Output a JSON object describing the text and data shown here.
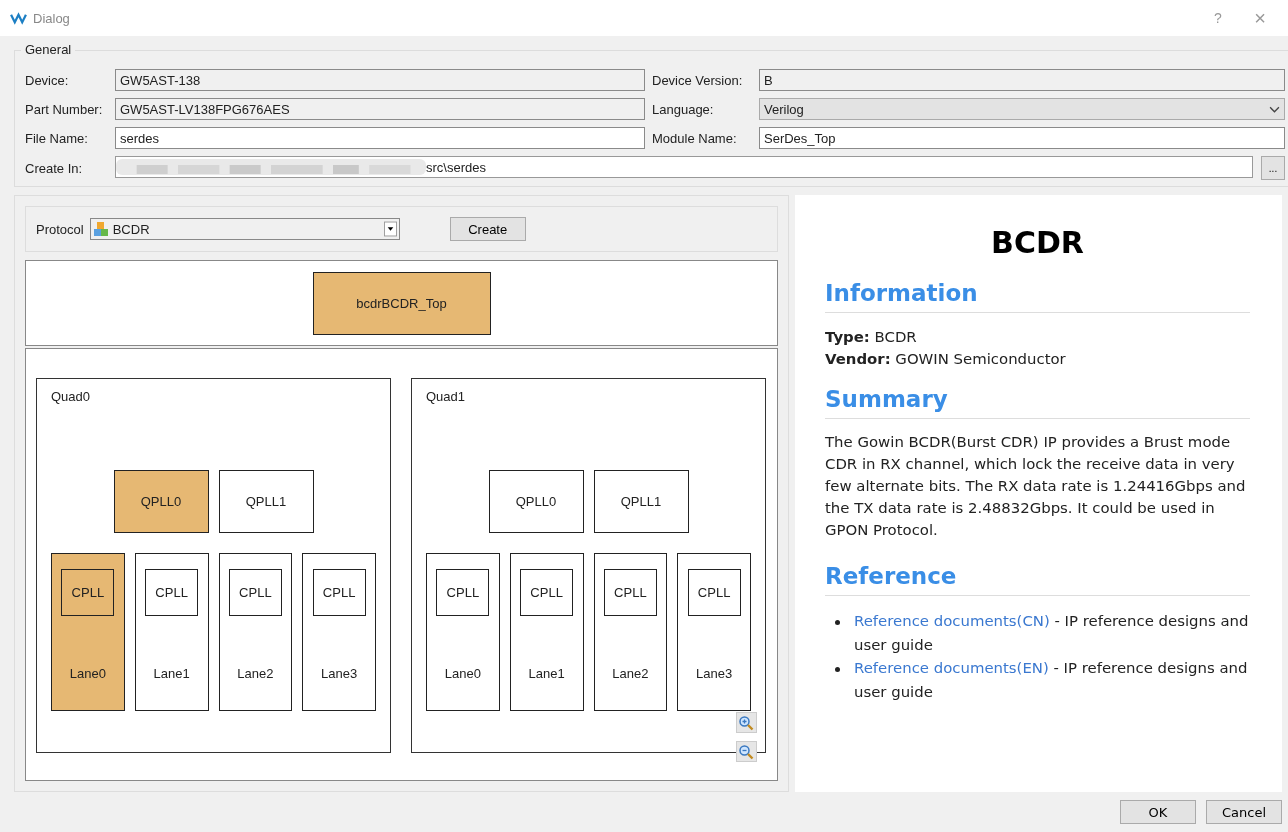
{
  "window": {
    "title": "Dialog",
    "help": "?",
    "close": "×"
  },
  "general": {
    "title": "General",
    "fields": [
      {
        "label": "Device:",
        "value": "GW5AST-138",
        "kind": "readonly"
      },
      {
        "label": "Device Version:",
        "value": "B",
        "kind": "readonly"
      },
      {
        "label": "Part Number:",
        "value": "GW5AST-LV138FPG676AES",
        "kind": "readonly"
      },
      {
        "label": "Language:",
        "value": "Verilog",
        "kind": "dropdown"
      },
      {
        "label": "File Name:",
        "value": "serdes",
        "kind": "text"
      },
      {
        "label": "Module Name:",
        "value": "SerDes_Top",
        "kind": "text"
      }
    ],
    "create_in": {
      "label": "Create In:",
      "value": "src\\serdes",
      "browse": "..."
    }
  },
  "protocol": {
    "label": "Protocol",
    "value": "BCDR",
    "create": "Create"
  },
  "top_block": {
    "label": "bcdrBCDR_Top",
    "selected": true
  },
  "quads": [
    {
      "name": "Quad0",
      "qplls": [
        {
          "label": "QPLL0",
          "selected": true
        },
        {
          "label": "QPLL1",
          "selected": false
        }
      ],
      "lanes": [
        {
          "label": "Lane0",
          "cpll": "CPLL",
          "selected": true
        },
        {
          "label": "Lane1",
          "cpll": "CPLL",
          "selected": false
        },
        {
          "label": "Lane2",
          "cpll": "CPLL",
          "selected": false
        },
        {
          "label": "Lane3",
          "cpll": "CPLL",
          "selected": false
        }
      ]
    },
    {
      "name": "Quad1",
      "qplls": [
        {
          "label": "QPLL0",
          "selected": false
        },
        {
          "label": "QPLL1",
          "selected": false
        }
      ],
      "lanes": [
        {
          "label": "Lane0",
          "cpll": "CPLL",
          "selected": false
        },
        {
          "label": "Lane1",
          "cpll": "CPLL",
          "selected": false
        },
        {
          "label": "Lane2",
          "cpll": "CPLL",
          "selected": false
        },
        {
          "label": "Lane3",
          "cpll": "CPLL",
          "selected": false
        }
      ]
    }
  ],
  "info": {
    "title": "BCDR",
    "sections": [
      {
        "heading": "Information",
        "kind": "lines",
        "lines": [
          "**Type:** BCDR",
          "**Vendor:** GOWIN Semiconductor"
        ]
      },
      {
        "heading": "Summary",
        "kind": "paragraph",
        "text": "The Gowin BCDR(Burst CDR) IP provides a Brust mode CDR in RX channel, which lock the receive data in very few alternate bits. The RX data rate is 1.24416Gbps and the TX data rate is 2.48832Gbps. It could be used in GPON Protocol."
      },
      {
        "heading": "Reference",
        "kind": "links",
        "items": [
          {
            "link": "Reference documents(CN)",
            "text": " - IP reference designs and user guide"
          },
          {
            "link": "Reference documents(EN)",
            "text": " - IP reference designs and user guide"
          }
        ]
      }
    ]
  },
  "buttons": [
    "OK",
    "Cancel"
  ]
}
